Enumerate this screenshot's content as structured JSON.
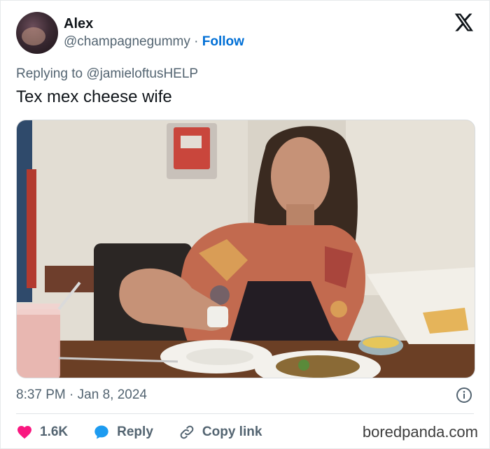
{
  "tweet": {
    "author_name": "Alex",
    "handle": "@champagnegummy",
    "separator": " · ",
    "follow_label": "Follow",
    "replying_prefix": "Replying to ",
    "replying_to": "@jamieloftusHELP",
    "text": "Tex mex cheese wife",
    "time": "8:37 PM",
    "date_separator": " · ",
    "date": "Jan 8, 2024"
  },
  "actions": {
    "like_count": "1.6K",
    "reply_label": "Reply",
    "copy_link_label": "Copy link"
  },
  "watermark": "boredpanda.com",
  "icons": {
    "logo": "x-logo-icon",
    "info": "info-icon",
    "like": "heart-icon",
    "reply": "speech-bubble-icon",
    "copy": "link-icon"
  },
  "colors": {
    "text": "#0f1419",
    "secondary": "#536471",
    "follow": "#006fd6",
    "like": "#f91880",
    "reply_icon": "#1d9bf0",
    "border": "#e6e9eb"
  }
}
